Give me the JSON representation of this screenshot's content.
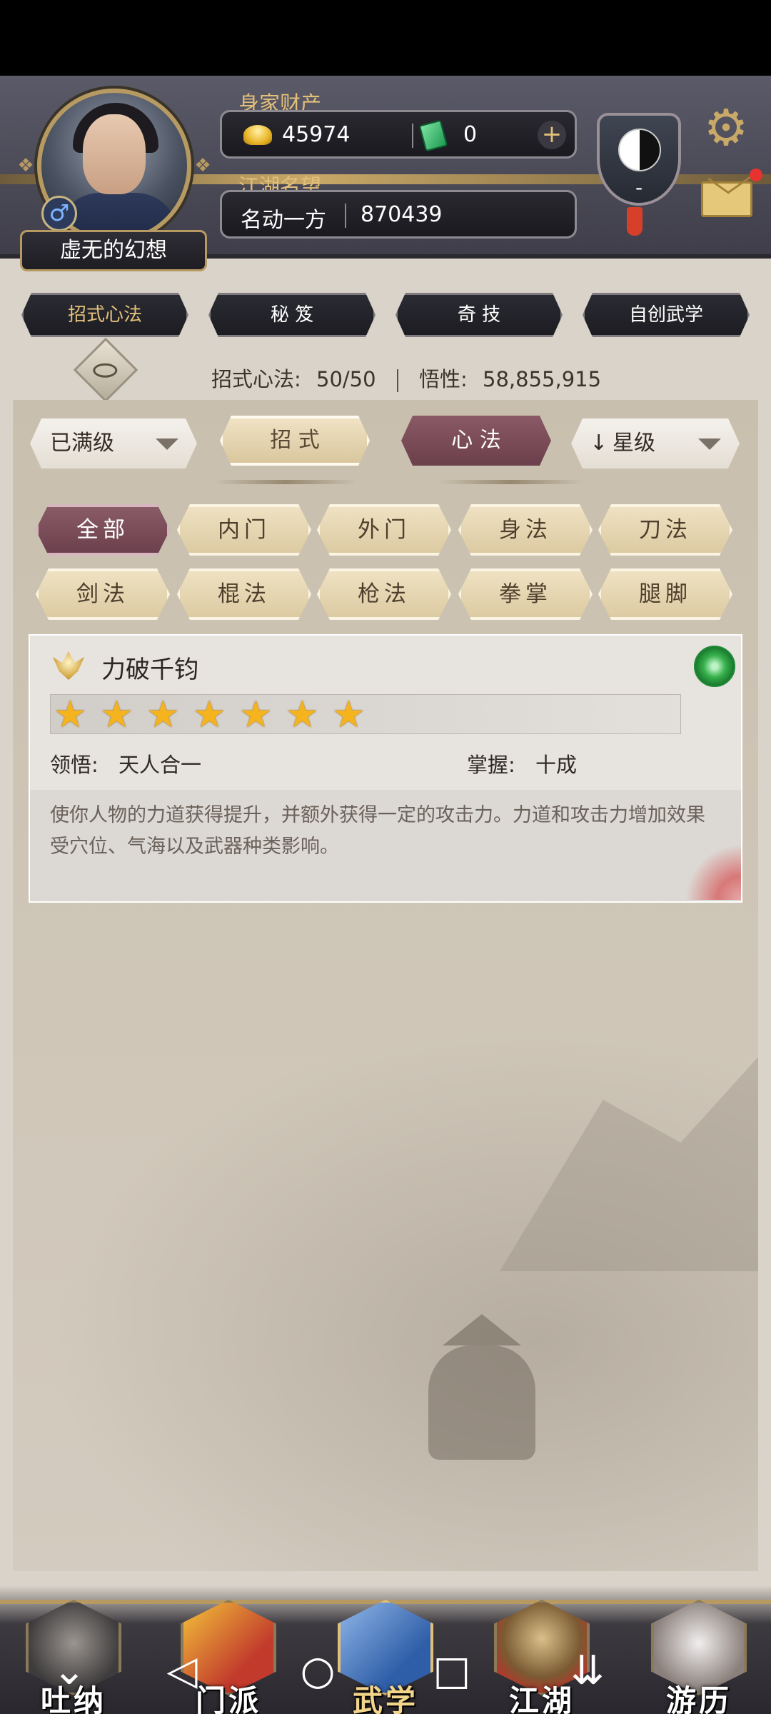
{
  "header": {
    "wealth_label": "身家财产",
    "gold_amount": "45974",
    "jade_amount": "0",
    "add_symbol": "+",
    "fame_label": "江湖名望",
    "fame_title": "名动一方",
    "fame_value": "870439",
    "player_name": "虚无的幻想",
    "gender_symbol": "♂",
    "rank_badge_text": "-",
    "settings_icon": "gear-icon",
    "mail_icon": "envelope-icon",
    "mail_notification": true
  },
  "top_tabs": [
    {
      "label": "招式心法",
      "active": true
    },
    {
      "label": "秘 笈",
      "active": false
    },
    {
      "label": "奇 技",
      "active": false
    },
    {
      "label": "自创武学",
      "active": false
    }
  ],
  "stats": {
    "skills_label": "招式心法:",
    "skills_value": "50/50",
    "insight_label": "悟性:",
    "insight_value": "58,855,915"
  },
  "controls": {
    "level_filter": "已满级",
    "seg_moves": "招 式",
    "seg_mind": "心 法",
    "sort_label": "星级",
    "sort_arrow": "↓"
  },
  "categories": [
    {
      "label": "全部",
      "active": true
    },
    {
      "label": "内门",
      "active": false
    },
    {
      "label": "外门",
      "active": false
    },
    {
      "label": "身法",
      "active": false
    },
    {
      "label": "刀法",
      "active": false
    },
    {
      "label": "剑法",
      "active": false
    },
    {
      "label": "棍法",
      "active": false
    },
    {
      "label": "枪法",
      "active": false
    },
    {
      "label": "拳掌",
      "active": false
    },
    {
      "label": "腿脚",
      "active": false
    }
  ],
  "skill_card": {
    "name": "力破千钧",
    "stars": 7,
    "comprehension_label": "领悟:",
    "comprehension_value": "天人合一",
    "mastery_label": "掌握:",
    "mastery_value": "十成",
    "description": "使你人物的力道获得提升，并额外获得一定的攻击力。力道和攻击力增加效果受穴位、气海以及武器种类影响。"
  },
  "bottom_nav": [
    {
      "label": "吐纳",
      "active": false
    },
    {
      "label": "门派",
      "active": false
    },
    {
      "label": "武学",
      "active": true
    },
    {
      "label": "江湖",
      "active": false
    },
    {
      "label": "游历",
      "active": false
    }
  ],
  "system_nav": {
    "down": "⌄",
    "back": "◁",
    "home": "○",
    "recent": "□",
    "menu": "⇊"
  },
  "colors": {
    "accent_gold": "#e3c07a",
    "active_tab": "#6b3f4b",
    "star": "#f5b31e"
  }
}
